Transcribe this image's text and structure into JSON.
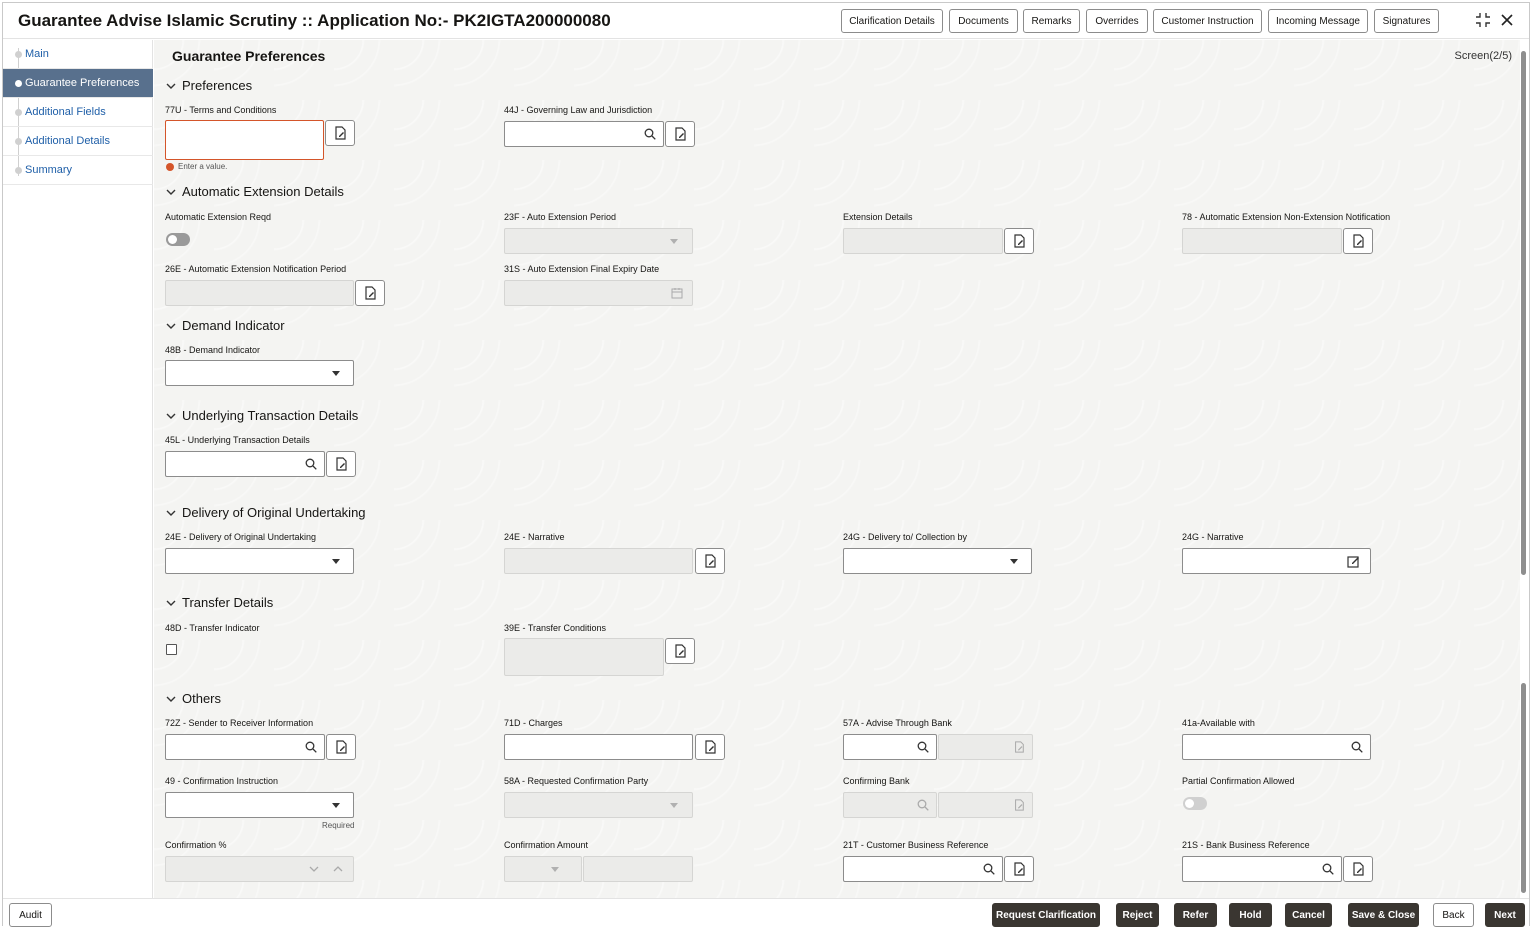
{
  "header": {
    "title": "Guarantee Advise Islamic Scrutiny :: Application No:- PK2IGTA200000080",
    "buttons": [
      "Clarification Details",
      "Documents",
      "Remarks",
      "Overrides",
      "Customer Instruction",
      "Incoming Message",
      "Signatures"
    ],
    "icons": [
      "collapse-icon",
      "close-icon"
    ]
  },
  "sidebar": {
    "items": [
      {
        "label": "Main",
        "active": false
      },
      {
        "label": "Guarantee Preferences",
        "active": true
      },
      {
        "label": "Additional Fields",
        "active": false
      },
      {
        "label": "Additional Details",
        "active": false
      },
      {
        "label": "Summary",
        "active": false
      }
    ]
  },
  "main": {
    "page_title": "Guarantee Preferences",
    "screen_indicator": "Screen(2/5)",
    "sections": {
      "preferences": "Preferences",
      "auto_ext": "Automatic Extension Details",
      "demand": "Demand Indicator",
      "underlying": "Underlying Transaction Details",
      "delivery": "Delivery of Original Undertaking",
      "transfer": "Transfer Details",
      "others": "Others"
    },
    "labels": {
      "terms": "77U - Terms and Conditions",
      "governing": "44J - Governing Law and Jurisdiction",
      "auto_reqd": "Automatic Extension Reqd",
      "auto_period": "23F - Auto Extension Period",
      "ext_details": "Extension Details",
      "non_ext": "78 - Automatic Extension Non-Extension Notification",
      "notif_period": "26E - Automatic Extension Notification Period",
      "final_expiry": "31S - Auto Extension Final Expiry Date",
      "demand_ind": "48B - Demand Indicator",
      "underlying_txn": "45L - Underlying Transaction Details",
      "delivery_orig": "24E - Delivery of Original Undertaking",
      "narrative_24e": "24E - Narrative",
      "delivery_to": "24G - Delivery to/ Collection by",
      "narrative_24g": "24G - Narrative",
      "transfer_ind": "48D - Transfer Indicator",
      "transfer_cond": "39E - Transfer Conditions",
      "sender_info": "72Z - Sender to Receiver Information",
      "charges": "71D - Charges",
      "advise_bank": "57A - Advise Through Bank",
      "available_with": "41a-Available with",
      "conf_instr": "49 - Confirmation Instruction",
      "req_conf_party": "58A - Requested Confirmation Party",
      "conf_bank": "Confirming Bank",
      "partial_conf": "Partial Confirmation Allowed",
      "conf_pct": "Confirmation %",
      "conf_amt": "Confirmation Amount",
      "cust_ref": "21T - Customer Business Reference",
      "bank_ref": "21S - Bank Business Reference"
    },
    "messages": {
      "enter_value": "Enter a value.",
      "required": "Required"
    }
  },
  "footer": {
    "audit": "Audit",
    "buttons": [
      "Request Clarification",
      "Reject",
      "Refer",
      "Hold",
      "Cancel",
      "Save & Close",
      "Back",
      "Next"
    ]
  }
}
